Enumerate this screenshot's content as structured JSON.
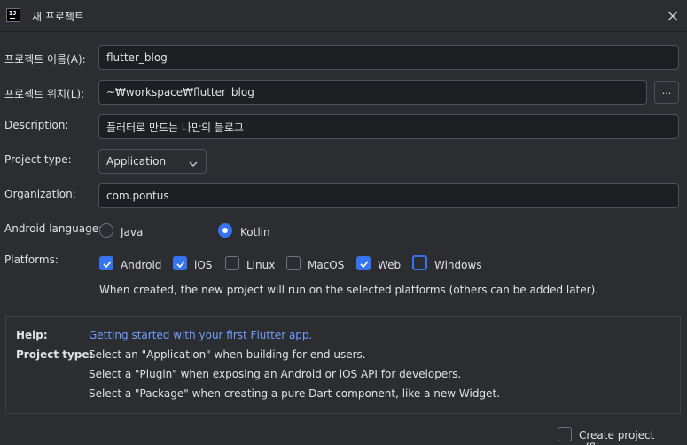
{
  "window": {
    "title": "새 프로젝트"
  },
  "form": {
    "name": {
      "label": "프로젝트 이름(A):",
      "value": "flutter_blog"
    },
    "location": {
      "label": "프로젝트 위치(L):",
      "value": "~₩workspace₩flutter_blog",
      "browse_label": "..."
    },
    "description": {
      "label": "Description:",
      "value": "플러터로 만드는 나만의 블로그"
    },
    "project_type": {
      "label": "Project type:",
      "selected": "Application"
    },
    "organization": {
      "label": "Organization:",
      "value": "com.pontus"
    },
    "android_language": {
      "label": "Android language:",
      "options": [
        {
          "label": "Java",
          "selected": false
        },
        {
          "label": "Kotlin",
          "selected": true
        }
      ]
    },
    "platforms": {
      "label": "Platforms:",
      "options": [
        {
          "label": "Android",
          "checked": true
        },
        {
          "label": "iOS",
          "checked": true
        },
        {
          "label": "Linux",
          "checked": false
        },
        {
          "label": "MacOS",
          "checked": false
        },
        {
          "label": "Web",
          "checked": true
        },
        {
          "label": "Windows",
          "checked": false,
          "focused": true
        }
      ],
      "note": "When created, the new project will run on the selected platforms (others can be added later)."
    }
  },
  "help": {
    "help_label": "Help:",
    "link": "Getting started with your first Flutter app.",
    "project_type_label": "Project type:",
    "lines": [
      "Select an \"Application\" when building for end users.",
      "Select a \"Plugin\" when exposing an Android or iOS API for developers.",
      "Select a \"Package\" when creating a pure Dart component, like a new Widget."
    ]
  },
  "footer": {
    "offline_label": "Create project offline",
    "offline_checked": false
  },
  "colors": {
    "background": "#2b2d30",
    "accent": "#3574f0",
    "link": "#6f9eff"
  }
}
